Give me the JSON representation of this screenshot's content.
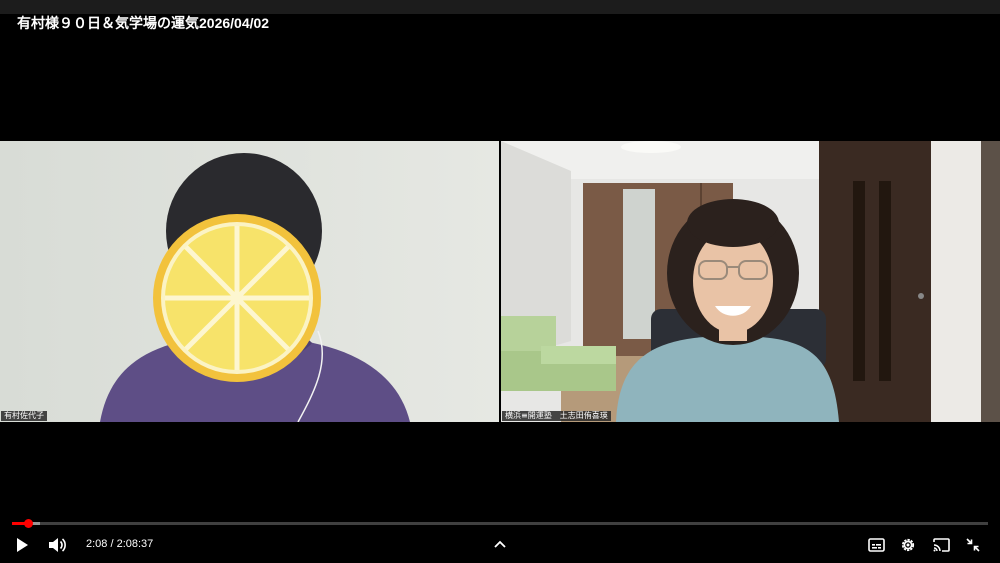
{
  "video": {
    "title": "有村様９０日＆気学場の運気2026/04/02",
    "current_time": "2:08",
    "time_separator": " / ",
    "duration": "2:08:37",
    "progress_fraction": 0.0166,
    "buffered_fraction": 0.029
  },
  "participants": [
    {
      "name": "有村佐代子"
    },
    {
      "name": "横浜≡開運塾　土志田侑喜瑛"
    }
  ],
  "colors": {
    "progress": "#ff0000",
    "lemon_peel": "#f2c23c",
    "lemon_flesh": "#f7e36a"
  },
  "icons": {
    "play": "play-icon",
    "volume": "volume-icon",
    "expand": "chevron-up-icon",
    "subtitles": "subtitles-icon",
    "settings": "gear-icon",
    "cast": "cast-icon",
    "exit_fullscreen": "exit-fullscreen-icon"
  }
}
